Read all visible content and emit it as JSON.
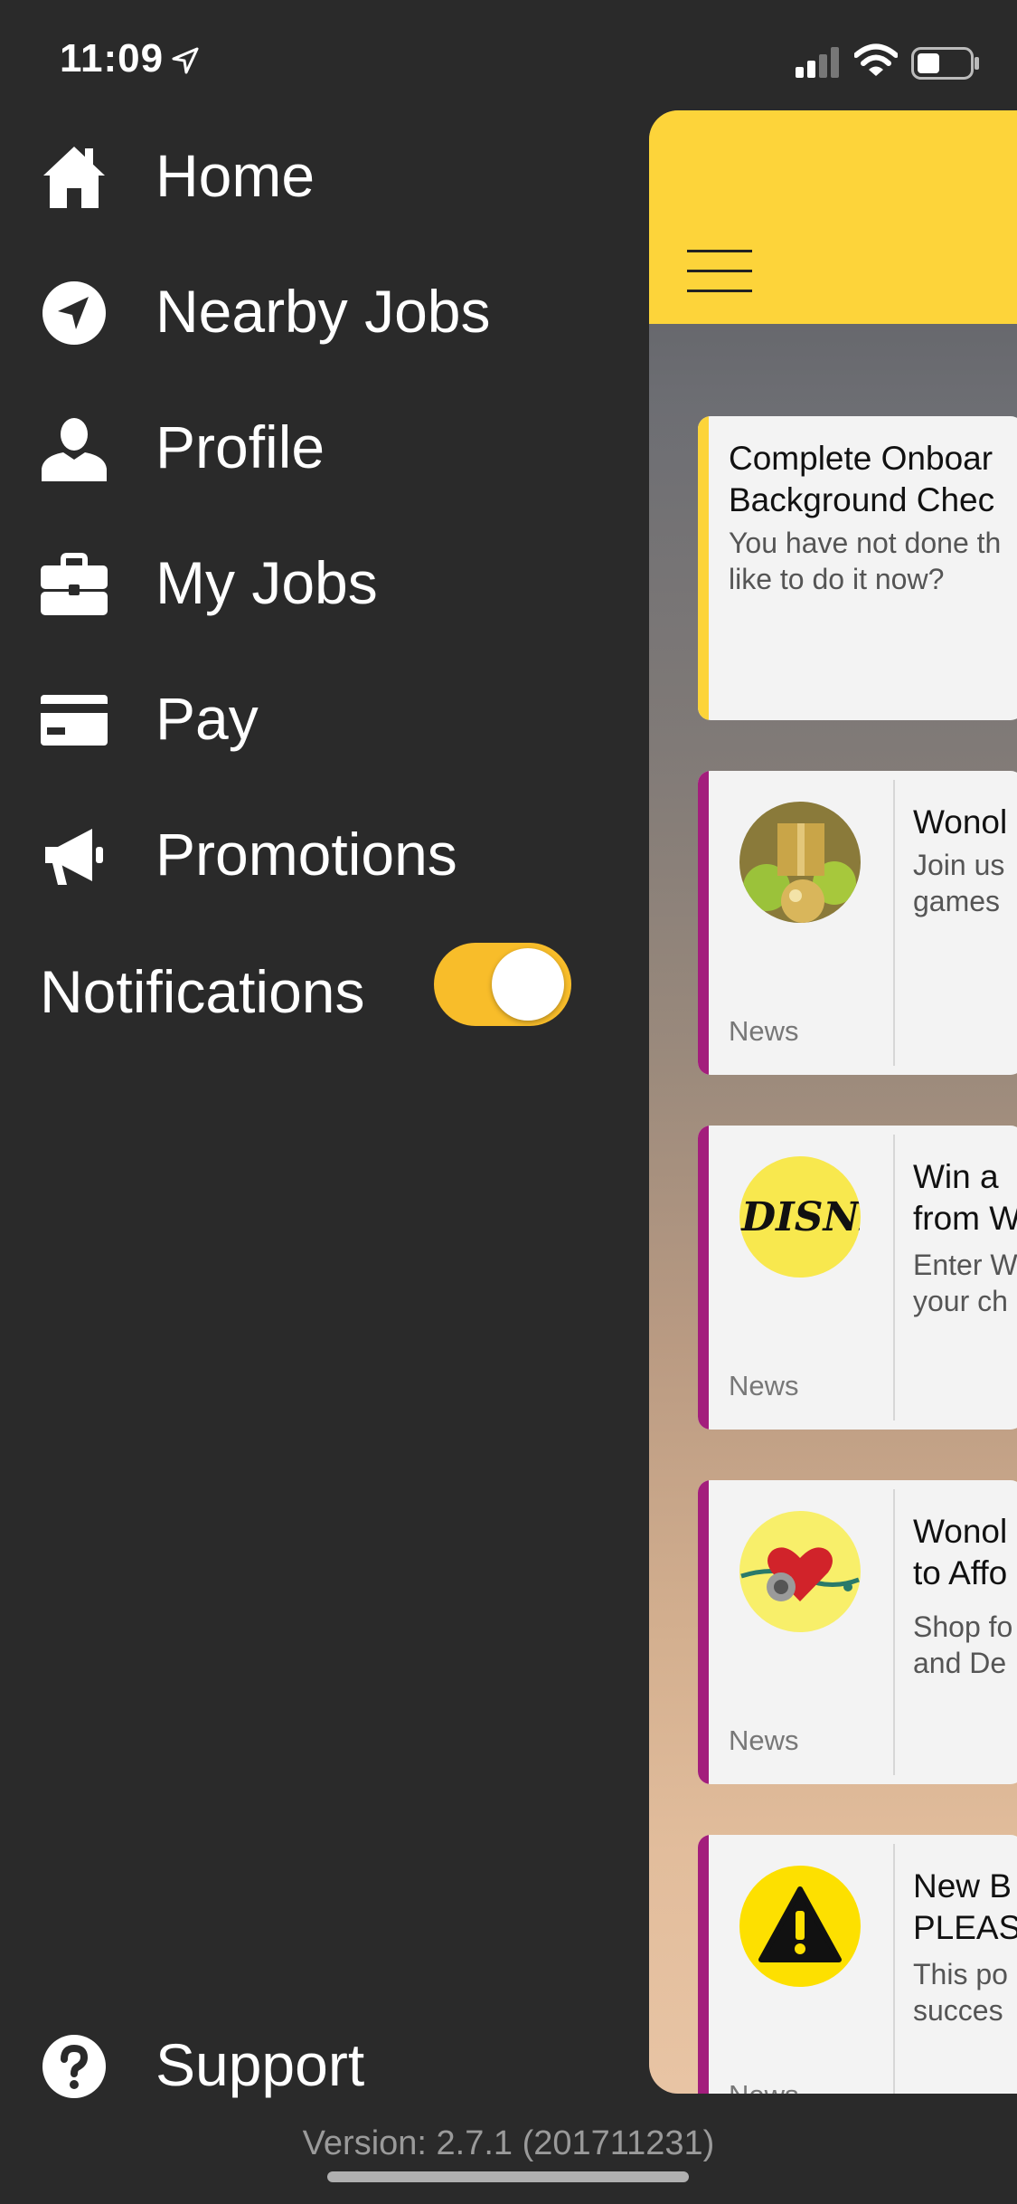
{
  "status_bar": {
    "time": "11:09"
  },
  "menu": {
    "items": [
      {
        "label": "Home",
        "icon": "home-icon"
      },
      {
        "label": "Nearby Jobs",
        "icon": "location-arrow-icon"
      },
      {
        "label": "Profile",
        "icon": "user-icon"
      },
      {
        "label": "My Jobs",
        "icon": "briefcase-icon"
      },
      {
        "label": "Pay",
        "icon": "credit-card-icon"
      },
      {
        "label": "Promotions",
        "icon": "megaphone-icon"
      }
    ],
    "notifications": {
      "label": "Notifications",
      "enabled": true
    },
    "support": {
      "label": "Support",
      "icon": "question-circle-icon"
    },
    "version": "Version: 2.7.1 (201711231)"
  },
  "colors": {
    "accent_yellow": "#fdd43a",
    "toggle_on": "#f8bd2a",
    "news_strip": "#a31e7c",
    "sidebar_bg": "#2a2a2a"
  },
  "feed": {
    "cards": [
      {
        "title_line1": "Complete Onboar",
        "title_line2": "Background Chec",
        "body_line1": "You have not done th",
        "body_line2": "like to do it now?",
        "tag": ""
      },
      {
        "title_line1": "Wonol",
        "title_line2": "",
        "body_line1": "Join us",
        "body_line2": "games",
        "tag": "News",
        "thumb": "ornaments-image"
      },
      {
        "title_line1": "Win a",
        "title_line2": "from W",
        "body_line1": "Enter W",
        "body_line2": "your ch",
        "tag": "News",
        "thumb": "disney-logo",
        "thumb_text": "DISNE"
      },
      {
        "title_line1": "Wonol",
        "title_line2": "to Affo",
        "body_line1": "Shop fo",
        "body_line2": "and De",
        "tag": "News",
        "thumb": "stethoscope-heart-image"
      },
      {
        "title_line1": "New B",
        "title_line2": "PLEAS",
        "body_line1": "This po",
        "body_line2": "succes",
        "tag": "News",
        "thumb": "warning-icon"
      }
    ]
  }
}
